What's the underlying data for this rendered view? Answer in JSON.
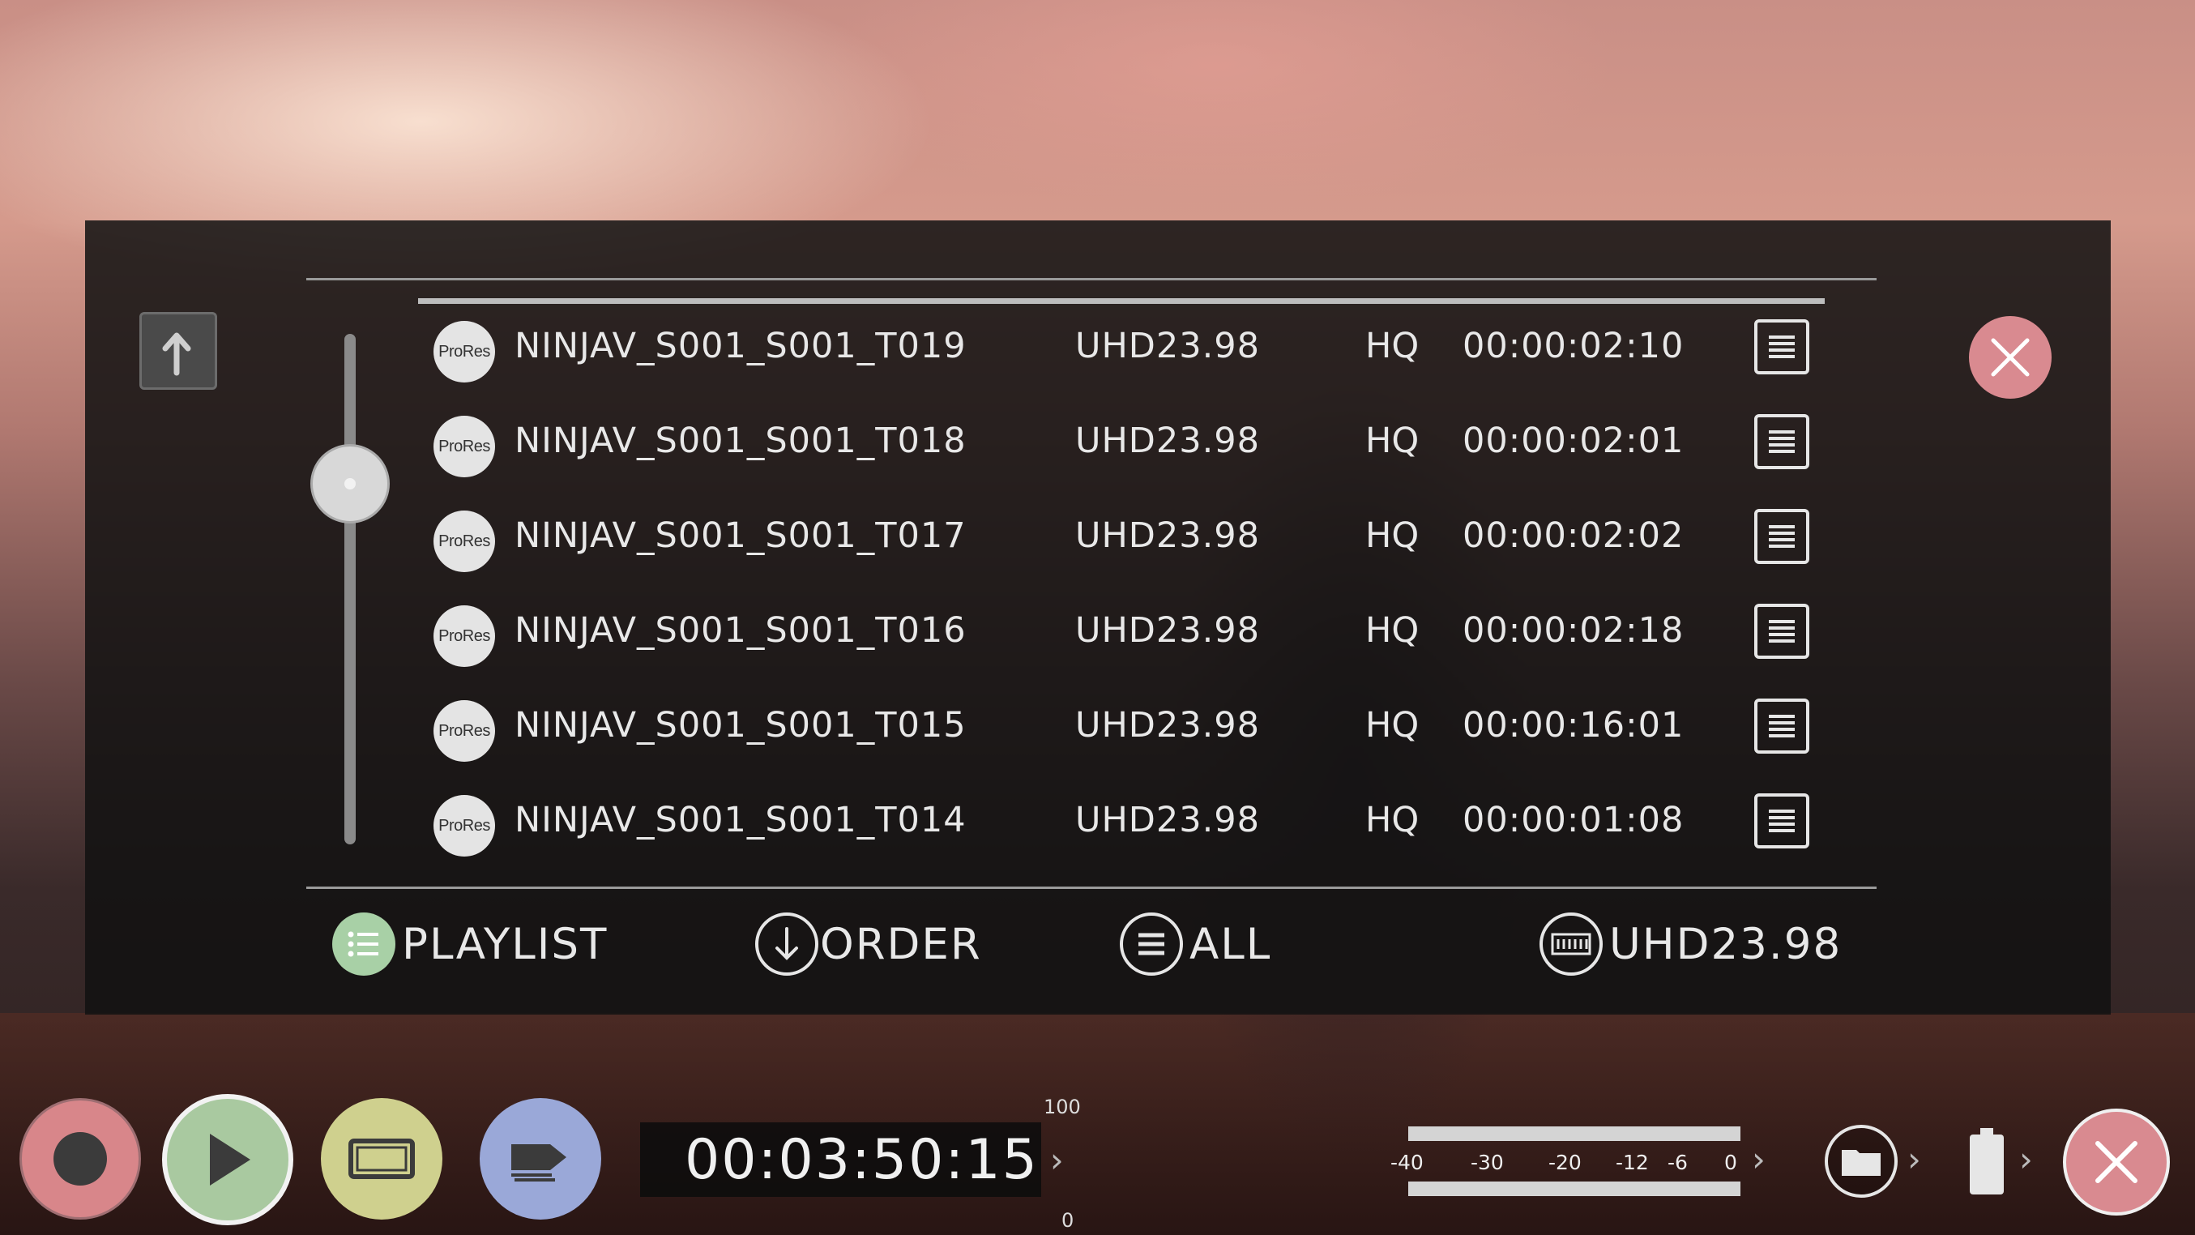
{
  "files": [
    {
      "codec": "ProRes",
      "name": "NINJAV_S001_S001_T019",
      "format": "UHD23.98",
      "quality": "HQ",
      "duration": "00:00:02:10"
    },
    {
      "codec": "ProRes",
      "name": "NINJAV_S001_S001_T018",
      "format": "UHD23.98",
      "quality": "HQ",
      "duration": "00:00:02:01"
    },
    {
      "codec": "ProRes",
      "name": "NINJAV_S001_S001_T017",
      "format": "UHD23.98",
      "quality": "HQ",
      "duration": "00:00:02:02"
    },
    {
      "codec": "ProRes",
      "name": "NINJAV_S001_S001_T016",
      "format": "UHD23.98",
      "quality": "HQ",
      "duration": "00:00:02:18"
    },
    {
      "codec": "ProRes",
      "name": "NINJAV_S001_S001_T015",
      "format": "UHD23.98",
      "quality": "HQ",
      "duration": "00:00:16:01"
    },
    {
      "codec": "ProRes",
      "name": "NINJAV_S001_S001_T014",
      "format": "UHD23.98",
      "quality": "HQ",
      "duration": "00:00:01:08"
    }
  ],
  "options": {
    "playlist": "PLAYLIST",
    "order": "ORDER",
    "filter": "ALL",
    "format": "UHD23.98"
  },
  "toolbar": {
    "timecode": "00:03:50:15",
    "scale_top": "100",
    "scale_bottom": "0",
    "meter_ticks": [
      "-40",
      "-30",
      "-20",
      "-12",
      "-6",
      "0"
    ]
  },
  "colors": {
    "record": "#d8868a",
    "play": "#a9c9a0",
    "display": "#cfd08e",
    "tag": "#9aa8d8",
    "close": "#d98a90",
    "playlist_icon": "#a8d0a6"
  },
  "icons": {
    "back": "return-arrow-icon",
    "close": "close-icon",
    "menu": "menu-lines-icon",
    "order": "down-arrow-icon",
    "filter": "list-icon",
    "format": "film-strip-icon",
    "folder": "folder-icon",
    "battery": "battery-icon"
  }
}
